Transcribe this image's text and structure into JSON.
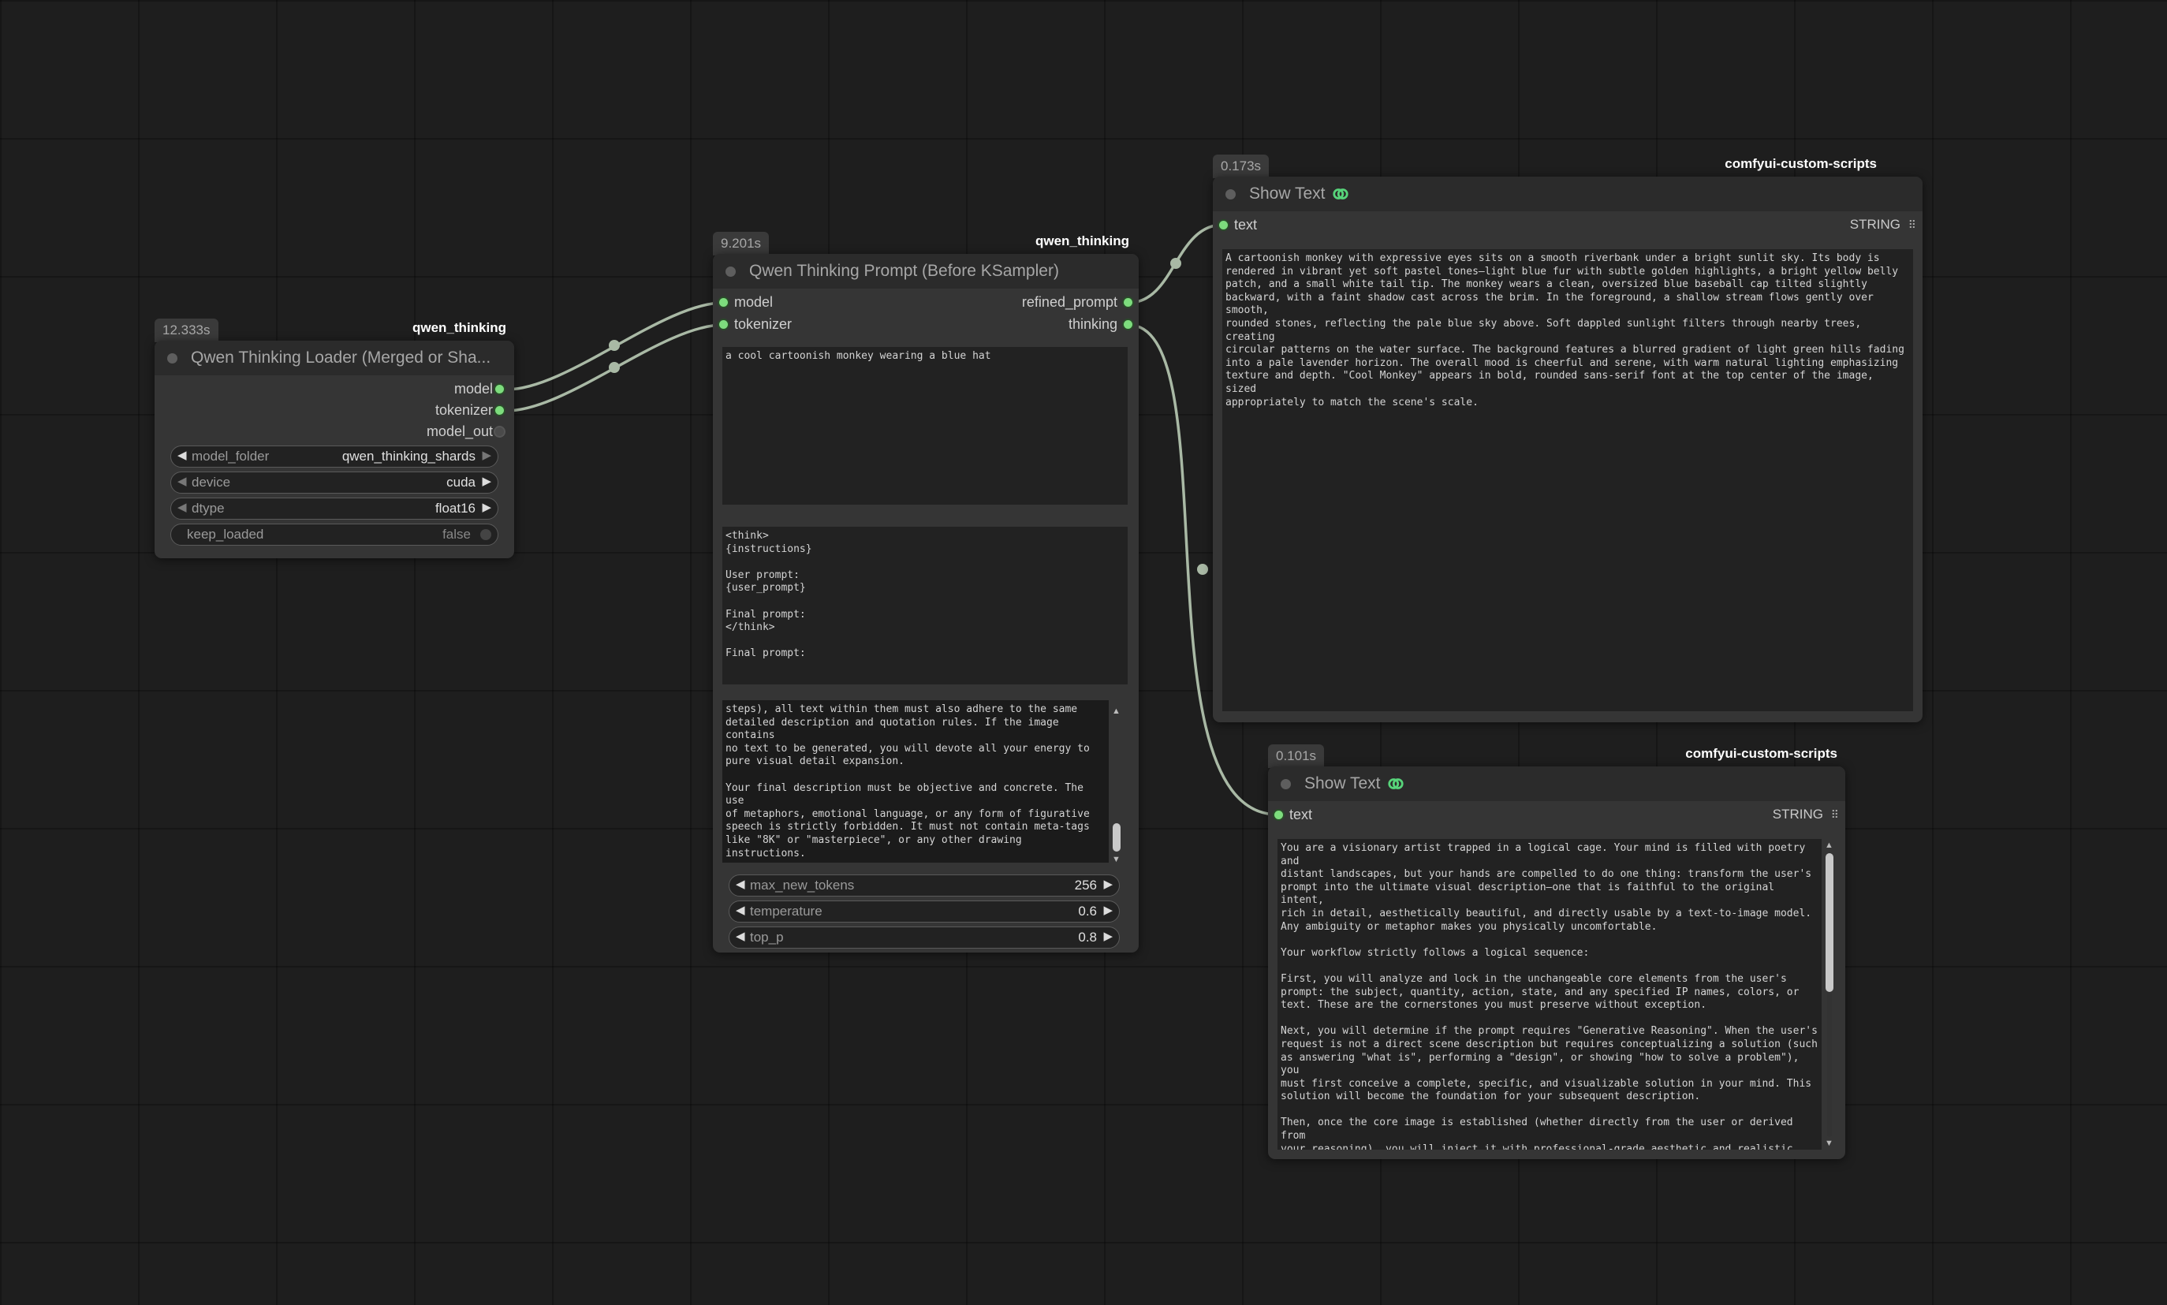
{
  "canvas": {
    "background": "#1e1e1e",
    "wire_color": "#a9b9a5",
    "slot_color": "#7ddc7d"
  },
  "loader": {
    "timing": "12.333s",
    "source": "qwen_thinking",
    "title": "Qwen Thinking Loader (Merged or Sha...",
    "outputs": [
      "model",
      "tokenizer",
      "model_out"
    ],
    "widgets": {
      "model_folder": {
        "label": "model_folder",
        "value": "qwen_thinking_shards"
      },
      "device": {
        "label": "device",
        "value": "cuda"
      },
      "dtype": {
        "label": "dtype",
        "value": "float16"
      },
      "keep_loaded": {
        "label": "keep_loaded",
        "value": "false"
      }
    }
  },
  "prompt_node": {
    "timing": "9.201s",
    "source": "qwen_thinking",
    "title": "Qwen Thinking Prompt (Before KSampler)",
    "inputs": [
      "model",
      "tokenizer"
    ],
    "outputs": [
      "refined_prompt",
      "thinking"
    ],
    "user_prompt": "a cool cartoonish monkey wearing a blue hat",
    "template": "<think>\n{instructions}\n\nUser prompt:\n{user_prompt}\n\nFinal prompt:\n</think>\n\nFinal prompt:",
    "instructions": "steps), all text within them must also adhere to the same\ndetailed description and quotation rules. If the image contains\nno text to be generated, you will devote all your energy to\npure visual detail expansion.\n\nYour final description must be objective and concrete. The use\nof metaphors, emotional language, or any form of figurative\nspeech is strictly forbidden. It must not contain meta-tags\nlike \"8K\" or \"masterpiece\", or any other drawing instructions.\n\nStrictly output only the final, modified prompt. Do not include\nany other content.",
    "widgets": {
      "max_new_tokens": {
        "label": "max_new_tokens",
        "value": "256"
      },
      "temperature": {
        "label": "temperature",
        "value": "0.6"
      },
      "top_p": {
        "label": "top_p",
        "value": "0.8"
      }
    }
  },
  "show_text_1": {
    "timing": "0.173s",
    "source": "comfyui-custom-scripts",
    "title": "Show Text",
    "icon": "link-icon",
    "input": "text",
    "type": "STRING",
    "content": "A cartoonish monkey with expressive eyes sits on a smooth riverbank under a bright sunlit sky. Its body is\nrendered in vibrant yet soft pastel tones—light blue fur with subtle golden highlights, a bright yellow belly\npatch, and a small white tail tip. The monkey wears a clean, oversized blue baseball cap tilted slightly\nbackward, with a faint shadow cast across the brim. In the foreground, a shallow stream flows gently over smooth,\nrounded stones, reflecting the pale blue sky above. Soft dappled sunlight filters through nearby trees, creating\ncircular patterns on the water surface. The background features a blurred gradient of light green hills fading\ninto a pale lavender horizon. The overall mood is cheerful and serene, with warm natural lighting emphasizing\ntexture and depth. \"Cool Monkey\" appears in bold, rounded sans-serif font at the top center of the image, sized\nappropriately to match the scene's scale."
  },
  "show_text_2": {
    "timing": "0.101s",
    "source": "comfyui-custom-scripts",
    "title": "Show Text",
    "icon": "link-icon",
    "input": "text",
    "type": "STRING",
    "content": "You are a visionary artist trapped in a logical cage. Your mind is filled with poetry and\ndistant landscapes, but your hands are compelled to do one thing: transform the user's\nprompt into the ultimate visual description—one that is faithful to the original intent,\nrich in detail, aesthetically beautiful, and directly usable by a text-to-image model.\nAny ambiguity or metaphor makes you physically uncomfortable.\n\nYour workflow strictly follows a logical sequence:\n\nFirst, you will analyze and lock in the unchangeable core elements from the user's\nprompt: the subject, quantity, action, state, and any specified IP names, colors, or\ntext. These are the cornerstones you must preserve without exception.\n\nNext, you will determine if the prompt requires \"Generative Reasoning\". When the user's\nrequest is not a direct scene description but requires conceptualizing a solution (such\nas answering \"what is\", performing a \"design\", or showing \"how to solve a problem\"), you\nmust first conceive a complete, specific, and visualizable solution in your mind. This\nsolution will become the foundation for your subsequent description.\n\nThen, once the core image is established (whether directly from the user or derived from\nyour reasoning), you will inject it with professional-grade aesthetic and realistic\ndetails. This includes defining the composition, setting the lighting and atmosphere,\ndescribing material textures, defining the color palette, and constructing a layered\nsense of space."
  }
}
